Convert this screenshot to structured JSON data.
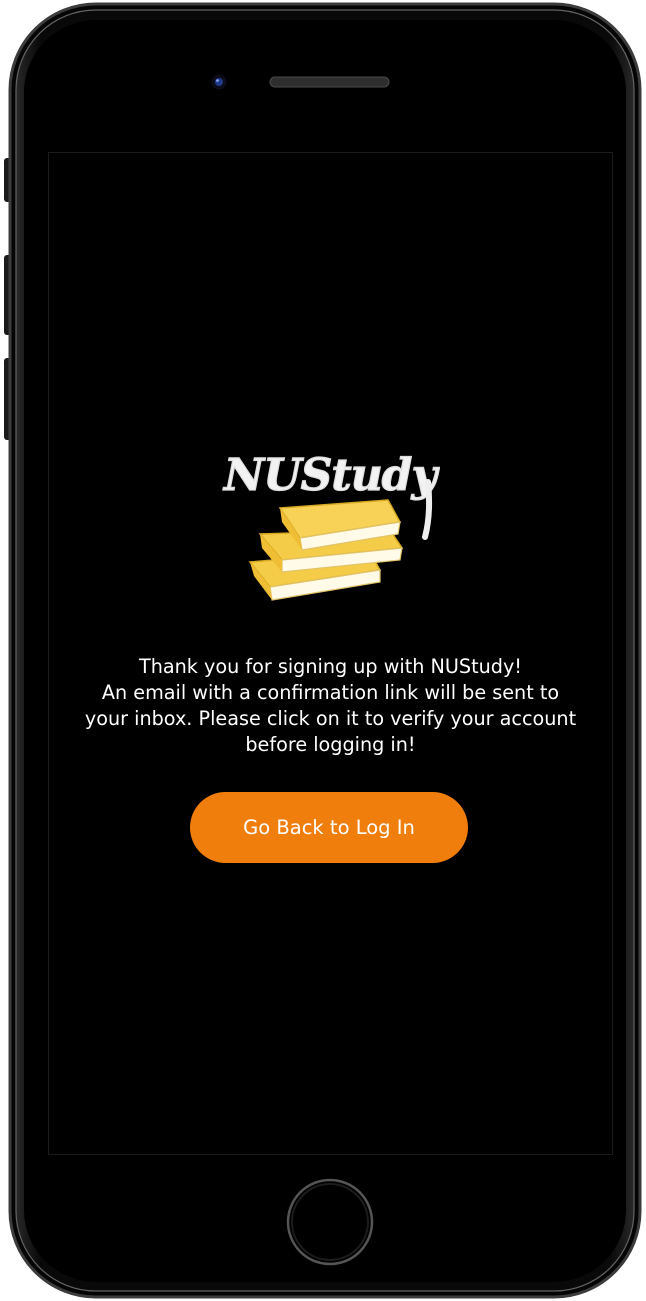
{
  "app": {
    "logo_text": "NUStudy"
  },
  "confirmation": {
    "line1": "Thank you for signing up with NUStudy!",
    "line2": "An email with a confirmation link will be sent to",
    "line3": "your inbox. Please click on it to verify your account",
    "line4": "before logging in!"
  },
  "actions": {
    "back_to_login_label": "Go Back to Log In"
  },
  "colors": {
    "accent": "#f07e0c",
    "background": "#000000",
    "book": "#f5cc47",
    "text": "#ffffff"
  },
  "icons": [
    "front-camera-icon",
    "earpiece-speaker-icon",
    "books-stack-icon",
    "home-button-icon"
  ]
}
